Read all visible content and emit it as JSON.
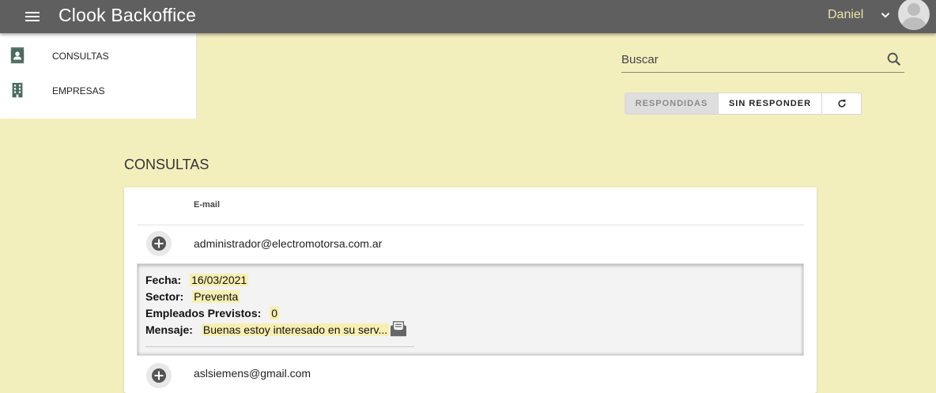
{
  "app": {
    "title": "Clook Backoffice",
    "user_name": "Daniel"
  },
  "sidenav": {
    "items": [
      {
        "label": "CONSULTAS",
        "icon": "contact-card-icon"
      },
      {
        "label": "EMPRESAS",
        "icon": "building-icon"
      }
    ]
  },
  "search": {
    "placeholder": "Buscar",
    "value": ""
  },
  "filter": {
    "buttons": [
      {
        "label": "RESPONDIDAS",
        "active": true
      },
      {
        "label": "SIN RESPONDER",
        "active": false
      },
      {
        "label": "",
        "icon": "refresh-icon"
      }
    ]
  },
  "section": {
    "title": "CONSULTAS"
  },
  "table": {
    "columns": [
      "E-mail"
    ],
    "rows": [
      {
        "email": "administrador@electromotorsa.com.ar",
        "expanded": true,
        "details": {
          "fecha_label": "Fecha:",
          "fecha": "16/03/2021",
          "sector_label": "Sector:",
          "sector": "Preventa",
          "empleados_label": "Empleados Previstos:",
          "empleados": "0",
          "mensaje_label": "Mensaje:",
          "mensaje": "Buenas estoy interesado en su serv..."
        }
      },
      {
        "email": "aslsiemens@gmail.com",
        "expanded": false
      }
    ]
  },
  "colors": {
    "appbar": "#5f5f5f",
    "background": "#f3efbd",
    "icon_green": "#4a6b5c",
    "highlight": "#f6efb1"
  }
}
